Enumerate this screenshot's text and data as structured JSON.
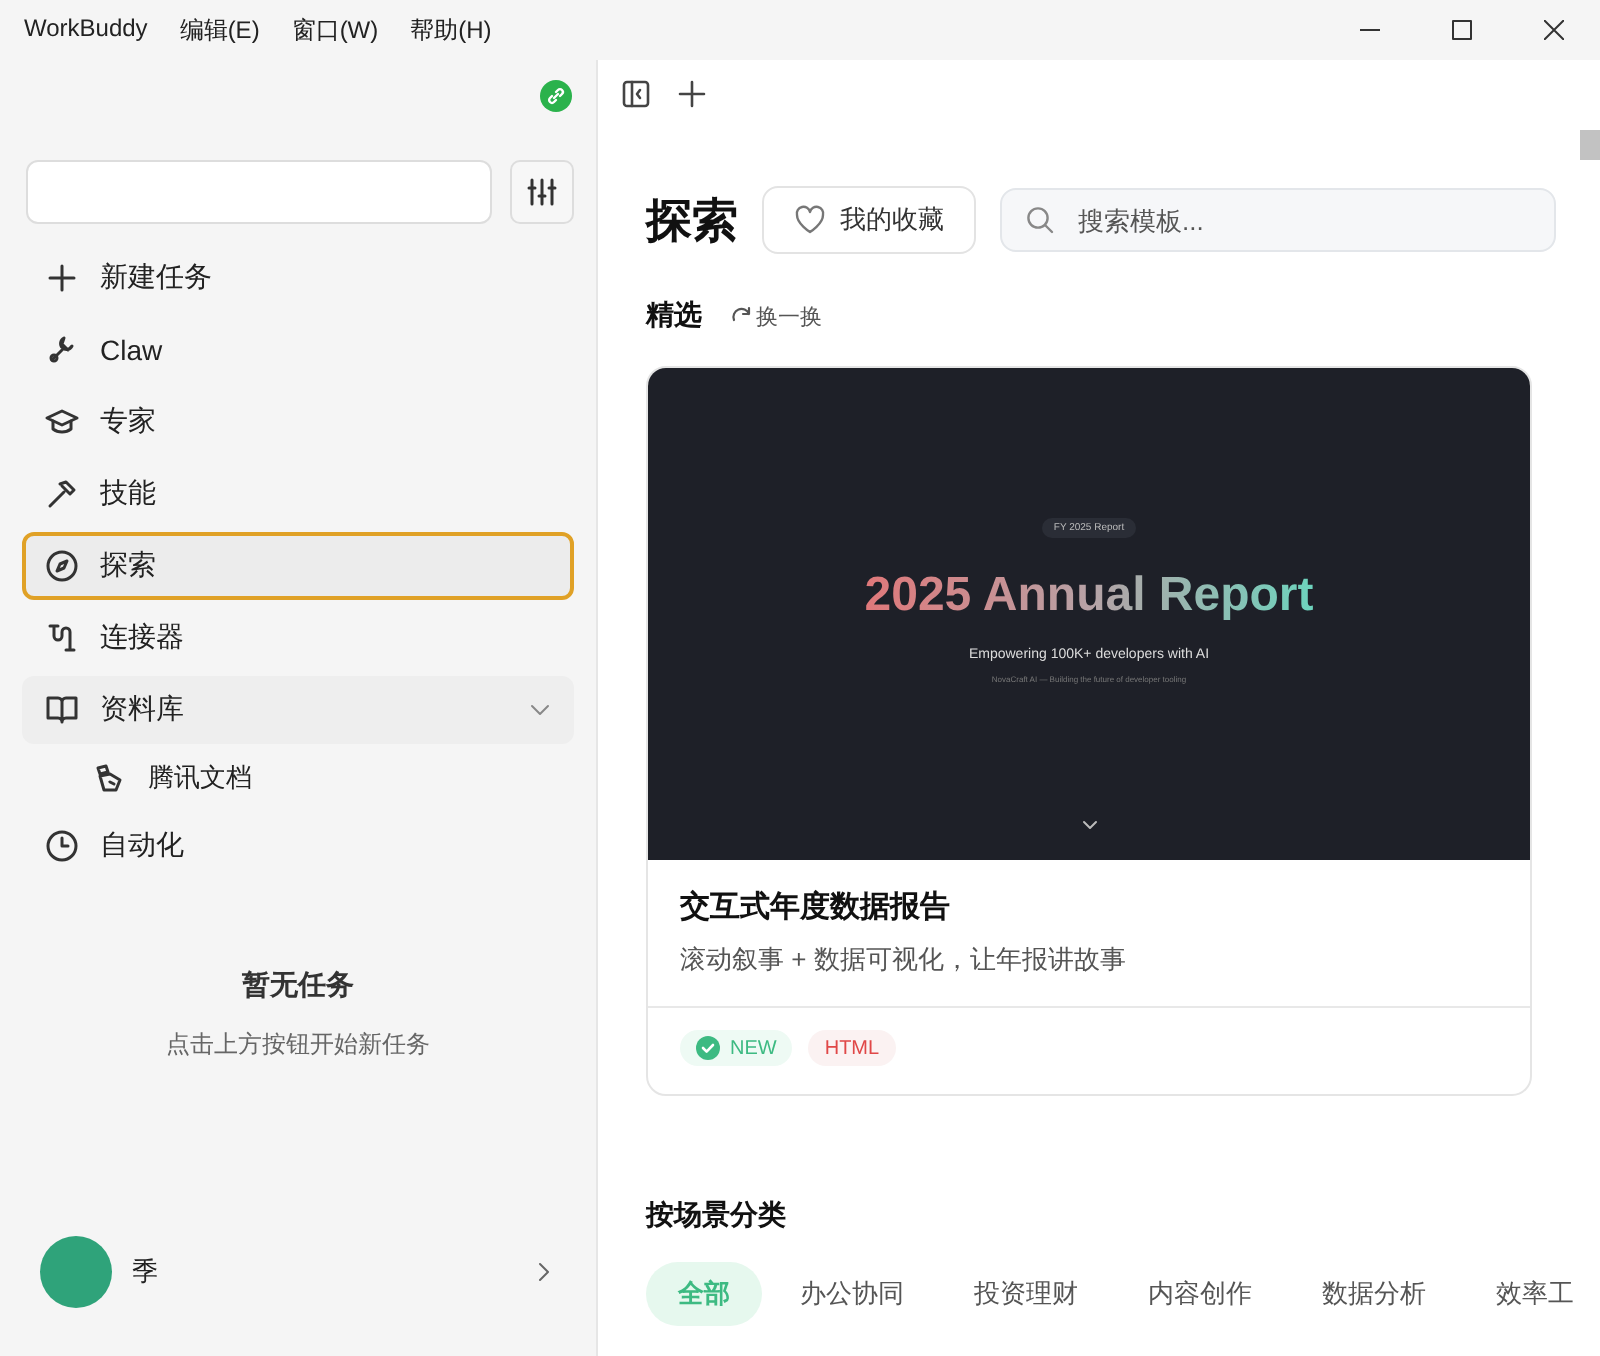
{
  "menu_bar": {
    "app_name": "WorkBuddy",
    "menus": [
      "编辑(E)",
      "窗口(W)",
      "帮助(H)"
    ]
  },
  "sidebar": {
    "items": [
      {
        "label": "新建任务",
        "selected": false
      },
      {
        "label": "Claw",
        "selected": false
      },
      {
        "label": "专家",
        "selected": false
      },
      {
        "label": "技能",
        "selected": false
      },
      {
        "label": "探索",
        "selected": true
      },
      {
        "label": "连接器",
        "selected": false
      },
      {
        "label": "资料库",
        "selected": false,
        "expanded": true,
        "children": [
          {
            "label": "腾讯文档",
            "selected": false
          }
        ]
      },
      {
        "label": "自动化",
        "selected": false
      }
    ],
    "empty_state": {
      "title": "暂无任务",
      "hint": "点击上方按钮开始新任务"
    },
    "user": {
      "name": "季"
    }
  },
  "main": {
    "title": "探索",
    "favorites_button": "我的收藏",
    "search": {
      "placeholder": "搜索模板..."
    },
    "featured": {
      "heading": "精选",
      "refresh": "换一换",
      "card": {
        "preview": {
          "badge": "FY 2025 Report",
          "headline": "2025 Annual Report",
          "subtitle": "Empowering 100K+ developers with AI",
          "tagline": "NovaCraft AI — Building the future of developer tooling"
        },
        "title": "交互式年度数据报告",
        "description": "滚动叙事 + 数据可视化，让年报讲故事",
        "tags": [
          {
            "label": "NEW",
            "kind": "new"
          },
          {
            "label": "HTML",
            "kind": "format"
          }
        ]
      }
    },
    "categories": {
      "heading": "按场景分类",
      "tabs": [
        {
          "label": "全部",
          "selected": true
        },
        {
          "label": "办公协同",
          "selected": false
        },
        {
          "label": "投资理财",
          "selected": false
        },
        {
          "label": "内容创作",
          "selected": false
        },
        {
          "label": "数据分析",
          "selected": false
        },
        {
          "label": "效率工",
          "selected": false
        }
      ]
    }
  }
}
